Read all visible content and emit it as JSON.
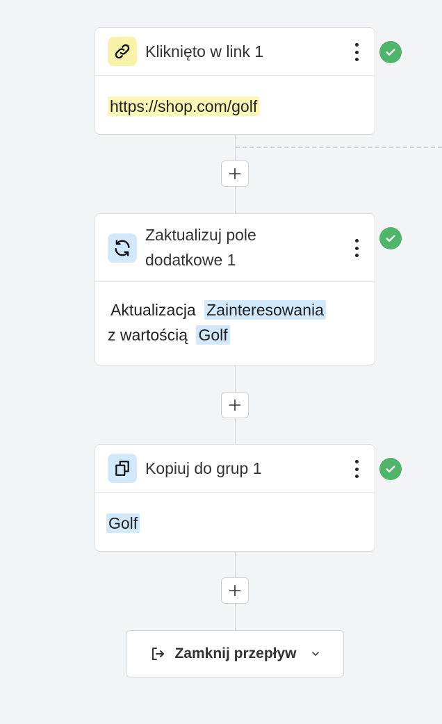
{
  "colors": {
    "background": "#f3f4f6",
    "success": "#4fb56b",
    "link_highlight": "#fbf7b4",
    "field_highlight": "#d2e8fb",
    "link_icon_bg": "#f8f3a8",
    "action_icon_bg": "#d2e8fb"
  },
  "steps": [
    {
      "title": "Kliknięto w link 1",
      "icon": "link-icon",
      "status_icon": "check-circle-icon",
      "url": "https://shop.com/golf"
    },
    {
      "title": "Zaktualizuj pole dodatkowe 1",
      "icon": "refresh-icon",
      "status_icon": "check-circle-icon",
      "prefix": "Aktualizacja",
      "field": "Zainteresowania",
      "middle": "z wartością",
      "value": "Golf"
    },
    {
      "title": "Kopiuj do grup 1",
      "icon": "copy-icon",
      "status_icon": "check-circle-icon",
      "group": "Golf"
    }
  ],
  "add_button_icon": "plus-icon",
  "end_flow": {
    "label": "Zamknij przepływ",
    "icon": "exit-icon",
    "chevron": "chevron-down-icon"
  }
}
